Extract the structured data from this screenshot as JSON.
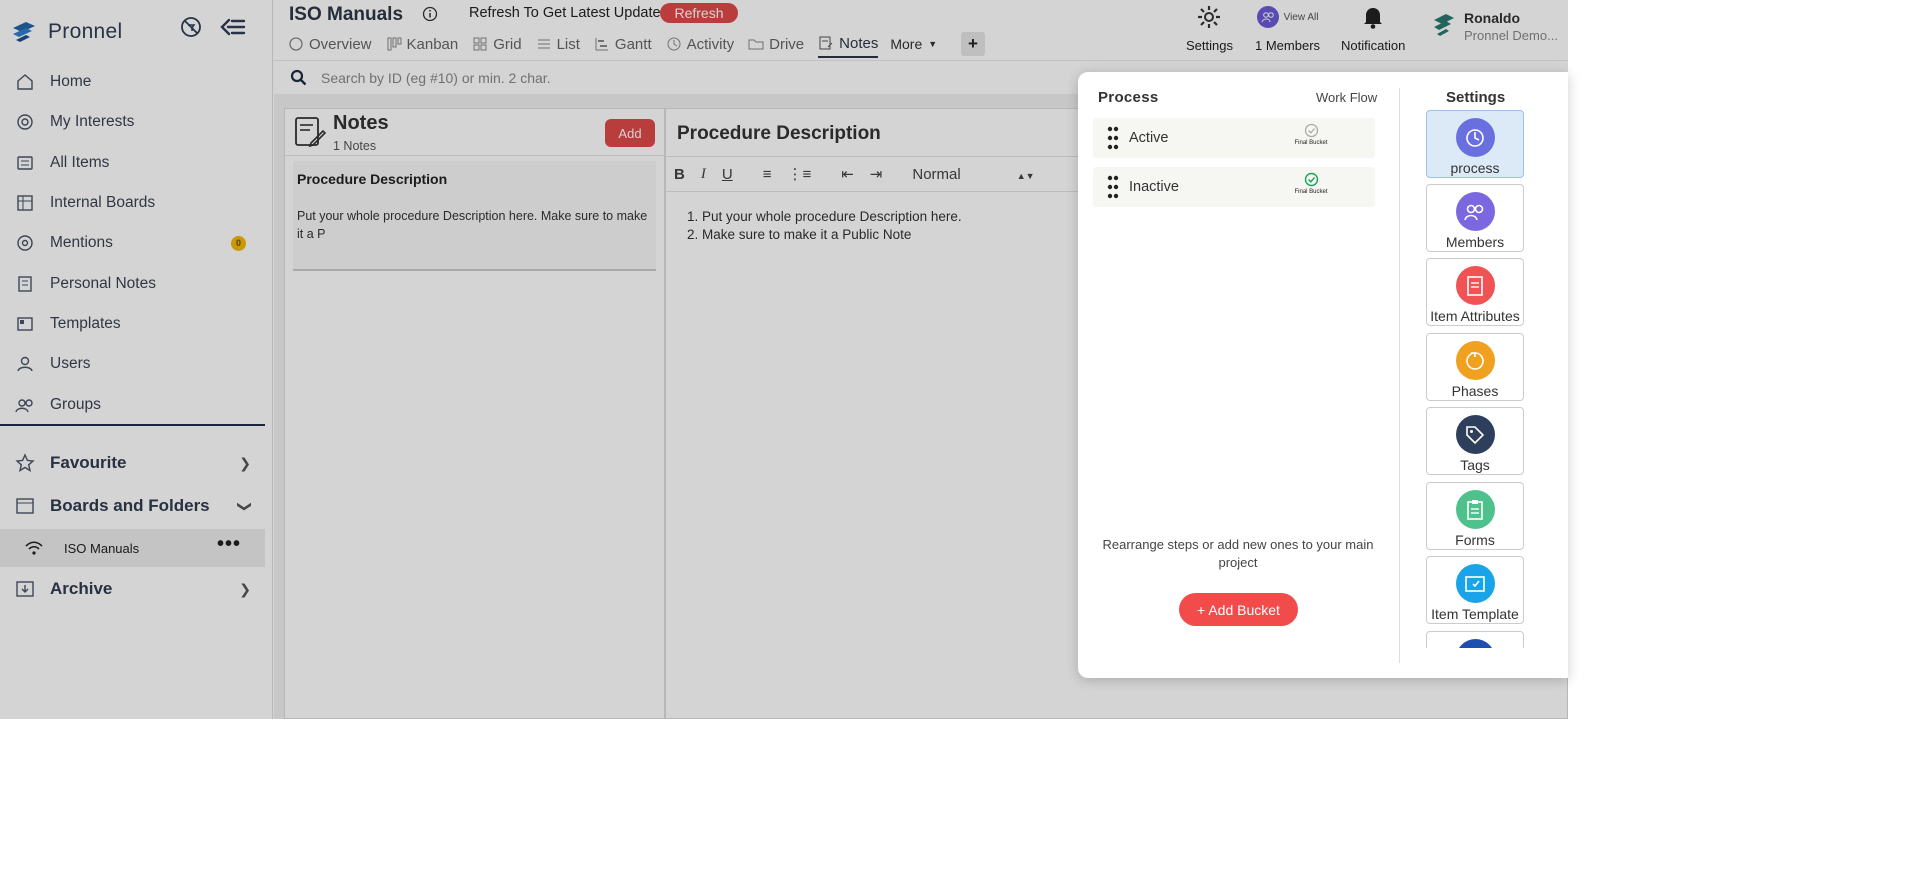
{
  "app": {
    "name": "Pronnel"
  },
  "sidebar": {
    "items": [
      {
        "label": "Home",
        "icon": "home-icon"
      },
      {
        "label": "My Interests",
        "icon": "interests-icon"
      },
      {
        "label": "All Items",
        "icon": "all-items-icon"
      },
      {
        "label": "Internal Boards",
        "icon": "boards-icon"
      },
      {
        "label": "Mentions",
        "icon": "mentions-icon",
        "badge": "0"
      },
      {
        "label": "Personal Notes",
        "icon": "notes-icon"
      },
      {
        "label": "Templates",
        "icon": "templates-icon"
      },
      {
        "label": "Users",
        "icon": "user-icon"
      },
      {
        "label": "Groups",
        "icon": "groups-icon"
      }
    ],
    "favourite": "Favourite",
    "boards_and_folders": "Boards and Folders",
    "board": "ISO Manuals",
    "archive": "Archive"
  },
  "header": {
    "title": "ISO Manuals",
    "refresh_text": "Refresh To Get Latest Updates",
    "refresh_btn": "Refresh",
    "tabs": [
      "Overview",
      "Kanban",
      "Grid",
      "List",
      "Gantt",
      "Activity",
      "Drive",
      "Notes"
    ],
    "active_tab": "Notes",
    "more": "More",
    "settings": "Settings",
    "view_all": "View All",
    "members": "1 Members",
    "notification": "Notification",
    "user_name": "Ronaldo",
    "user_org": "Pronnel Demo..."
  },
  "search": {
    "placeholder": "Search by ID (eg #10) or min. 2 char."
  },
  "notes": {
    "title": "Notes",
    "count": "1 Notes",
    "add": "Add",
    "card_title": "Procedure Description",
    "card_body": "Put your whole procedure Description here. Make sure to make it a P"
  },
  "editor": {
    "title": "Procedure Description",
    "format": "Normal",
    "lines": [
      "Put your whole procedure Description here.",
      "Make sure to make it a Public Note"
    ]
  },
  "modal": {
    "process_title": "Process",
    "workflow": "Work Flow",
    "buckets": [
      {
        "label": "Active",
        "tag": "Final Bucket"
      },
      {
        "label": "Inactive",
        "tag": "Final Bucket"
      }
    ],
    "hint": "Rearrange steps or add new ones to your main project",
    "add_bucket": "+ Add Bucket",
    "settings_title": "Settings",
    "settings_items": [
      {
        "label": "process",
        "color": "#6a6fe0"
      },
      {
        "label": "Members",
        "color": "#7b68e0"
      },
      {
        "label": "Item Attributes",
        "color": "#ef5353"
      },
      {
        "label": "Phases",
        "color": "#f0a11f"
      },
      {
        "label": "Tags",
        "color": "#2e3f5c"
      },
      {
        "label": "Forms",
        "color": "#4fc18d"
      },
      {
        "label": "Item Template",
        "color": "#1aa3e8"
      }
    ]
  }
}
